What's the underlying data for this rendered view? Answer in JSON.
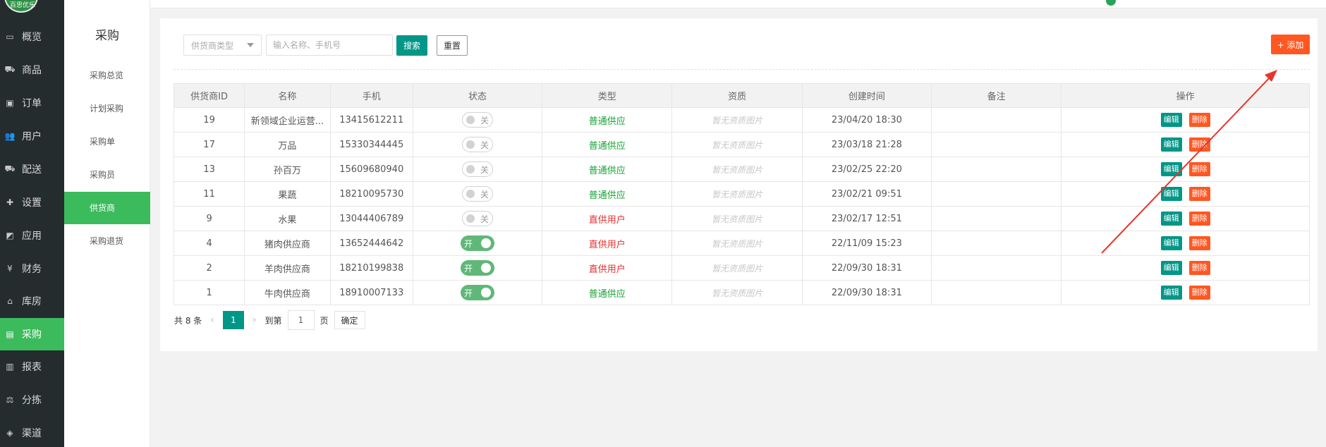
{
  "nav": {
    "logo_text": "百思优乐",
    "items": [
      {
        "label": "概览",
        "icon": "monitor-icon",
        "glyph": "▭"
      },
      {
        "label": "商品",
        "icon": "cart-icon",
        "glyph": "⛟"
      },
      {
        "label": "订单",
        "icon": "order-icon",
        "glyph": "▣"
      },
      {
        "label": "用户",
        "icon": "users-icon",
        "glyph": "👥"
      },
      {
        "label": "配送",
        "icon": "truck-icon",
        "glyph": "⛟"
      },
      {
        "label": "设置",
        "icon": "puzzle-icon",
        "glyph": "✚"
      },
      {
        "label": "应用",
        "icon": "app-icon",
        "glyph": "◩"
      },
      {
        "label": "财务",
        "icon": "yen-icon",
        "glyph": "¥"
      },
      {
        "label": "库房",
        "icon": "home-icon",
        "glyph": "⌂"
      },
      {
        "label": "采购",
        "icon": "bus-icon",
        "glyph": "▤"
      },
      {
        "label": "报表",
        "icon": "bar-chart-icon",
        "glyph": "▥"
      },
      {
        "label": "分拣",
        "icon": "scale-icon",
        "glyph": "⚖"
      },
      {
        "label": "渠道",
        "icon": "box-icon",
        "glyph": "◈"
      }
    ],
    "active_index": 9
  },
  "subnav": {
    "title": "采购",
    "items": [
      "采购总览",
      "计划采购",
      "采购单",
      "采购员",
      "供货商",
      "采购退货"
    ],
    "active_index": 4
  },
  "toolbar": {
    "select_placeholder": "供货商类型",
    "search_placeholder": "输入名称、手机号",
    "search_label": "搜索",
    "reset_label": "重置",
    "add_label": "+ 添加"
  },
  "table": {
    "headers": [
      "供货商ID",
      "名称",
      "手机",
      "状态",
      "类型",
      "资质",
      "创建时间",
      "备注",
      "操作"
    ],
    "edit_label": "编辑",
    "delete_label": "删除",
    "on_label": "开",
    "off_label": "关",
    "rows": [
      {
        "id": "19",
        "name": "新领域企业运营...",
        "phone": "13415612211",
        "status": false,
        "type": "普通供应",
        "type_color": "green",
        "qual": "暂无资质图片",
        "created": "23/04/20 18:30",
        "note": ""
      },
      {
        "id": "17",
        "name": "万品",
        "phone": "15330344445",
        "status": false,
        "type": "普通供应",
        "type_color": "green",
        "qual": "暂无资质图片",
        "created": "23/03/18 21:28",
        "note": ""
      },
      {
        "id": "13",
        "name": "孙百万",
        "phone": "15609680940",
        "status": false,
        "type": "普通供应",
        "type_color": "green",
        "qual": "暂无资质图片",
        "created": "23/02/25 22:20",
        "note": ""
      },
      {
        "id": "11",
        "name": "果蔬",
        "phone": "18210095730",
        "status": false,
        "type": "普通供应",
        "type_color": "green",
        "qual": "暂无资质图片",
        "created": "23/02/21 09:51",
        "note": ""
      },
      {
        "id": "9",
        "name": "水果",
        "phone": "13044406789",
        "status": false,
        "type": "直供用户",
        "type_color": "red",
        "qual": "暂无资质图片",
        "created": "23/02/17 12:51",
        "note": ""
      },
      {
        "id": "4",
        "name": "猪肉供应商",
        "phone": "13652444642",
        "status": true,
        "type": "直供用户",
        "type_color": "red",
        "qual": "暂无资质图片",
        "created": "22/11/09 15:23",
        "note": ""
      },
      {
        "id": "2",
        "name": "羊肉供应商",
        "phone": "18210199838",
        "status": true,
        "type": "直供用户",
        "type_color": "red",
        "qual": "暂无资质图片",
        "created": "22/09/30 18:31",
        "note": ""
      },
      {
        "id": "1",
        "name": "牛肉供应商",
        "phone": "18910007133",
        "status": true,
        "type": "普通供应",
        "type_color": "green",
        "qual": "暂无资质图片",
        "created": "22/09/30 18:31",
        "note": ""
      }
    ]
  },
  "pager": {
    "total": "共 8 条",
    "current": "1",
    "goto_label": "到第",
    "goto_value": "1",
    "page_label": "页",
    "ok_label": "确定"
  },
  "colors": {
    "nav_bg": "#252c2e",
    "active_green": "#3cbb5c",
    "primary": "#009688",
    "danger": "#ff5722",
    "annotation_red": "#e8352b"
  }
}
